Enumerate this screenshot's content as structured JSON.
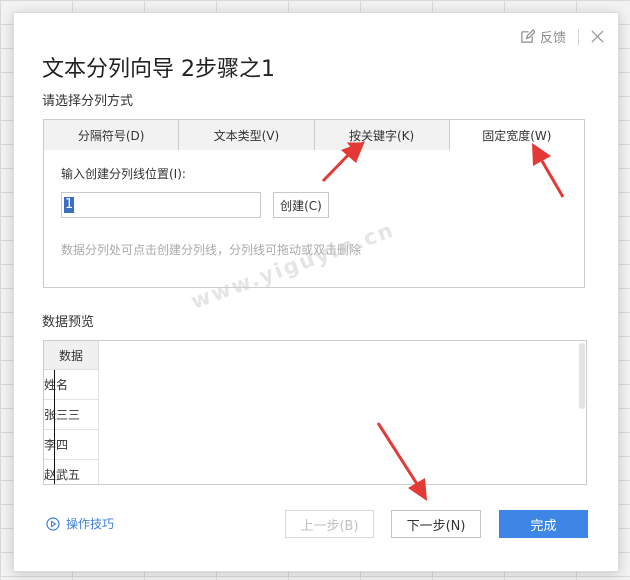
{
  "dialog": {
    "title": "文本分列向导 2步骤之1",
    "feedback_label": "反馈",
    "subtitle": "请选择分列方式"
  },
  "tabs": [
    {
      "label": "分隔符号(D)",
      "active": false
    },
    {
      "label": "文本类型(V)",
      "active": false
    },
    {
      "label": "按关键字(K)",
      "active": false
    },
    {
      "label": "固定宽度(W)",
      "active": true
    }
  ],
  "fixed_width": {
    "position_label": "输入创建分列线位置(I):",
    "position_value": "1",
    "create_button": "创建(C)",
    "hint": "数据分列处可点击创建分列线，分列线可拖动或双击删除"
  },
  "preview": {
    "label": "数据预览",
    "header": "数据",
    "rows": [
      "姓名",
      "张三三",
      "李四",
      "赵武五"
    ]
  },
  "footer": {
    "tips_label": "操作技巧",
    "prev_label": "上一步(B)",
    "next_label": "下一步(N)",
    "finish_label": "完成"
  },
  "watermark": "www.yiguyin.cn",
  "colors": {
    "accent": "#3e86e6",
    "link": "#3d7fd6",
    "annotation_arrow": "#e53935"
  }
}
